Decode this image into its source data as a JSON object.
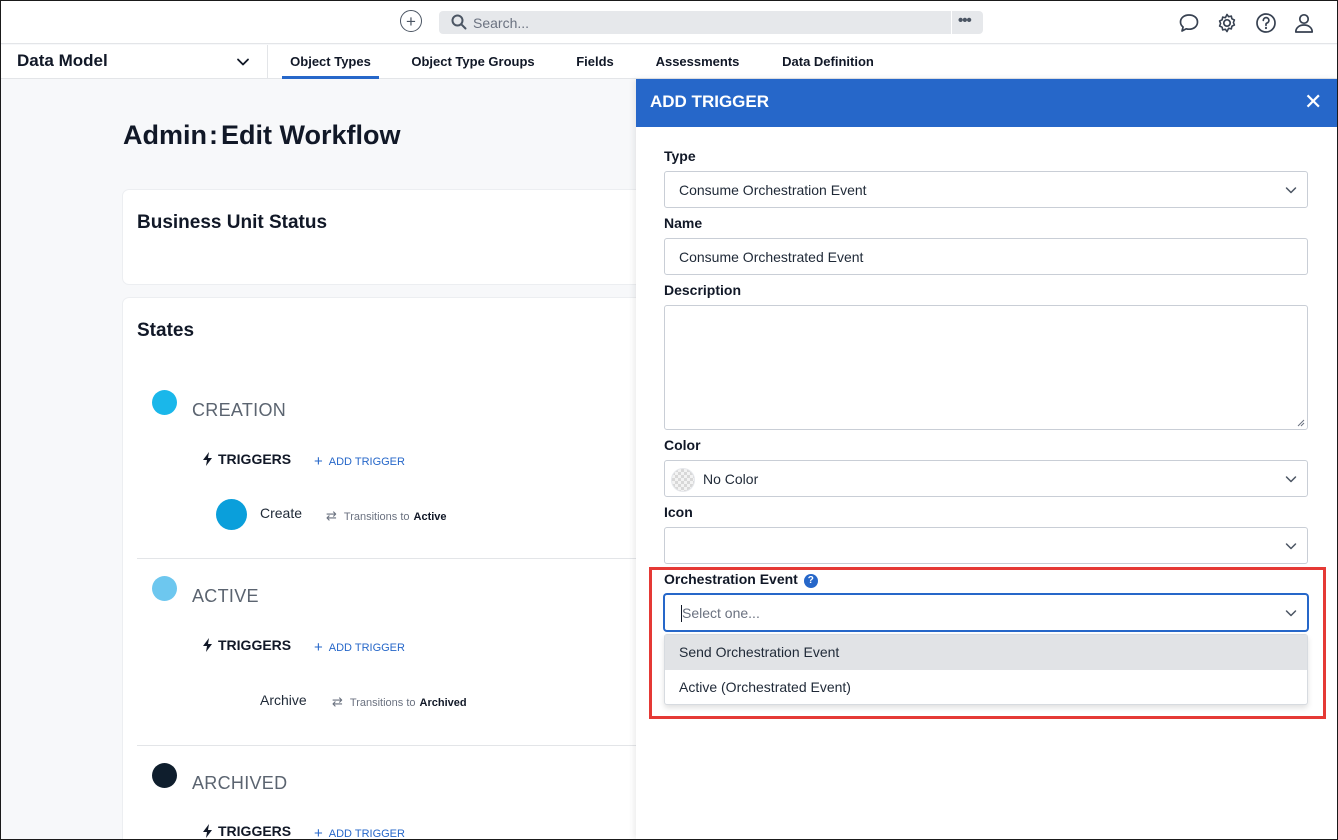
{
  "topbar": {
    "search_placeholder": "Search...",
    "more_label": "•••",
    "plus_label": "+"
  },
  "subnav": {
    "module": "Data Model",
    "tabs": [
      {
        "label": "Object Types",
        "active": true
      },
      {
        "label": "Object Type Groups",
        "active": false
      },
      {
        "label": "Fields",
        "active": false
      },
      {
        "label": "Assessments",
        "active": false
      },
      {
        "label": "Data Definition",
        "active": false
      }
    ]
  },
  "page": {
    "title_prefix": "Admin",
    "title_sep": ":",
    "title_main": "Edit Workflow",
    "workflow_name": "Business Unit Status",
    "states_title": "States",
    "states": [
      {
        "name": "CREATION",
        "color": "#1ab7ea",
        "triggers_label": "TRIGGERS",
        "add_trigger": "ADD TRIGGER",
        "trigger": {
          "name": "Create",
          "transitions_label": "Transitions to",
          "target": "Active"
        }
      },
      {
        "name": "ACTIVE",
        "color": "#6dc7ef",
        "triggers_label": "TRIGGERS",
        "add_trigger": "ADD TRIGGER",
        "trigger": {
          "name": "Archive",
          "transitions_label": "Transitions to",
          "target": "Archived"
        }
      },
      {
        "name": "ARCHIVED",
        "color": "#0f1e2d",
        "triggers_label": "TRIGGERS",
        "add_trigger": "ADD TRIGGER"
      }
    ]
  },
  "panel": {
    "title": "ADD TRIGGER",
    "close_label": "✕",
    "type_label": "Type",
    "type_value": "Consume Orchestration Event",
    "name_label": "Name",
    "name_value": "Consume Orchestrated Event",
    "description_label": "Description",
    "description_value": "",
    "color_label": "Color",
    "color_value": "No Color",
    "icon_label": "Icon",
    "icon_value": "",
    "orch_label": "Orchestration Event",
    "orch_help": "?",
    "orch_placeholder": "Select one...",
    "orch_options": [
      "Send Orchestration Event",
      "Active (Orchestrated Event)"
    ]
  },
  "colors": {
    "accent": "#2667c9",
    "highlight_box": "#e53935"
  }
}
